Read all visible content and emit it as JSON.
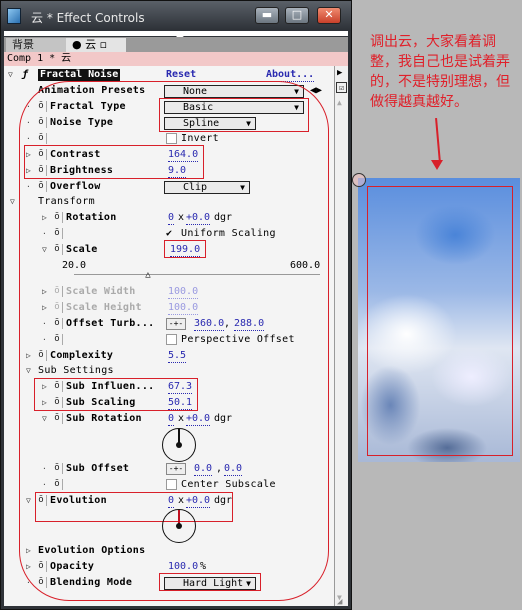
{
  "window": {
    "title": "云 * Effect Controls",
    "min": "▬",
    "max": "□",
    "close": "✕"
  },
  "tabs": [
    {
      "label": "背景"
    },
    {
      "label": "云",
      "icon": "effect-icon"
    }
  ],
  "comp_label": "Comp 1 * 云",
  "effect": {
    "name": "Fractal Noise",
    "reset": "Reset",
    "about": "About..."
  },
  "params": {
    "animation_presets": {
      "label": "Animation Presets",
      "value": "None"
    },
    "fractal_type": {
      "label": "Fractal Type",
      "value": "Basic"
    },
    "noise_type": {
      "label": "Noise Type",
      "value": "Spline"
    },
    "invert": {
      "label": "Invert",
      "checked": false
    },
    "contrast": {
      "label": "Contrast",
      "value": "164.0"
    },
    "brightness": {
      "label": "Brightness",
      "value": "9.0"
    },
    "overflow": {
      "label": "Overflow",
      "value": "Clip"
    },
    "transform": {
      "label": "Transform"
    },
    "rotation": {
      "label": "Rotation",
      "rev": "0",
      "x": "x",
      "deg": "+0.0",
      "unit": "dgr"
    },
    "uniform_scaling": {
      "label": "Uniform Scaling",
      "checked": true,
      "mark": "✔"
    },
    "scale": {
      "label": "Scale",
      "value": "199.0",
      "min": "20.0",
      "max": "600.0",
      "fraction": 0.31
    },
    "scale_width": {
      "label": "Scale Width",
      "value": "100.0"
    },
    "scale_height": {
      "label": "Scale Height",
      "value": "100.0"
    },
    "offset_turb": {
      "label": "Offset Turb...",
      "x": "360.0",
      "y": "288.0",
      "sep": ","
    },
    "perspective_offset": {
      "label": "Perspective Offset",
      "checked": false
    },
    "complexity": {
      "label": "Complexity",
      "value": "5.5"
    },
    "sub_settings": {
      "label": "Sub Settings"
    },
    "sub_influence": {
      "label": "Sub Influen...",
      "value": "67.3"
    },
    "sub_scaling": {
      "label": "Sub Scaling",
      "value": "50.1"
    },
    "sub_rotation": {
      "label": "Sub Rotation",
      "rev": "0",
      "x": "x",
      "deg": "+0.0",
      "unit": "dgr"
    },
    "sub_offset": {
      "label": "Sub Offset",
      "x": "0.0",
      "y": "0.0",
      "sep": ","
    },
    "center_subscale": {
      "label": "Center Subscale",
      "checked": false
    },
    "evolution": {
      "label": "Evolution",
      "rev": "0",
      "x": "x",
      "deg": "+0.0",
      "unit": "dgr"
    },
    "evolution_options": {
      "label": "Evolution Options"
    },
    "opacity": {
      "label": "Opacity",
      "value": "100.0",
      "unit": "%"
    },
    "blending_mode": {
      "label": "Blending Mode",
      "value": "Hard Light"
    }
  },
  "annotation": {
    "text": "调出云，大家看着调整，我自己也是试着弄的，不是特别理想，但做得越真越好。"
  },
  "colors": {
    "highlight": "#d8202a",
    "value_link": "#2a2ab0"
  }
}
